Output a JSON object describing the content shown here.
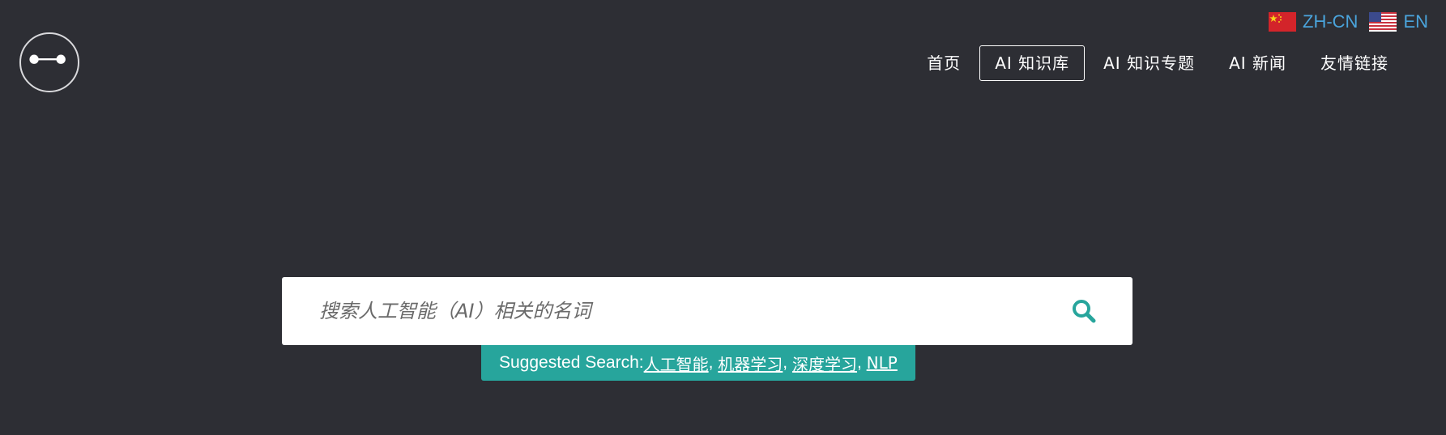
{
  "header": {
    "logo_icon": "link-node-icon",
    "languages": [
      {
        "code": "ZH-CN",
        "flag": "china-flag-icon"
      },
      {
        "code": "EN",
        "flag": "us-flag-icon"
      }
    ],
    "nav": [
      {
        "label": "首页",
        "active": false
      },
      {
        "label": "AI 知识库",
        "active": true
      },
      {
        "label": "AI 知识专题",
        "active": false
      },
      {
        "label": "AI 新闻",
        "active": false
      },
      {
        "label": "友情链接",
        "active": false
      }
    ]
  },
  "search": {
    "placeholder": "搜索人工智能（AI）相关的名词",
    "value": "",
    "icon": "search-icon"
  },
  "suggested": {
    "prefix": "Suggested Search: ",
    "items": [
      "人工智能",
      "机器学习",
      "深度学习",
      "NLP"
    ],
    "separator": ", "
  },
  "colors": {
    "background": "#2d2e34",
    "accent": "#27a59c",
    "link": "#4aa4dc",
    "search_icon": "#27a59c"
  }
}
